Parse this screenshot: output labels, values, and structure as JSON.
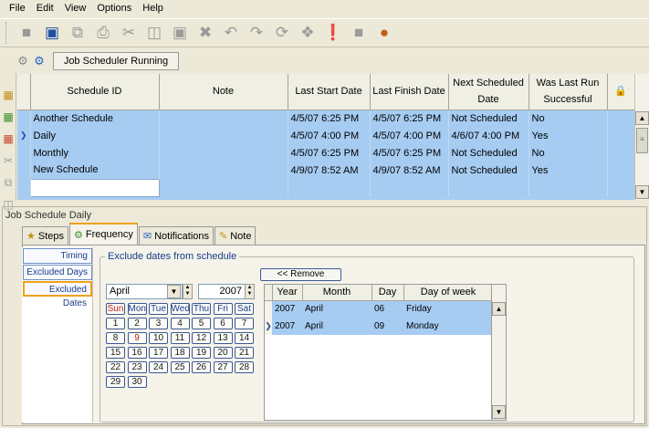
{
  "menu": [
    "File",
    "Edit",
    "View",
    "Options",
    "Help"
  ],
  "toolbar_icons": [
    "new-icon",
    "save-icon",
    "copy-icon",
    "print-icon",
    "cut-icon",
    "paste-icon",
    "clipboard-icon",
    "delete-icon",
    "undo-icon",
    "redo-icon",
    "refresh-icon",
    "link-icon",
    "unlink-icon",
    "settings-icon",
    "user-icon"
  ],
  "status": {
    "label": "Job Scheduler Running"
  },
  "grid": {
    "columns": [
      "Schedule ID",
      "Note",
      "Last Start Date",
      "Last Finish Date",
      "Next Scheduled Date",
      "Was Last Run Successful"
    ],
    "rows": [
      {
        "id": "Another Schedule",
        "note": "",
        "last_start": "4/5/07 6:25 PM",
        "last_finish": "4/5/07 6:25 PM",
        "next": "Not Scheduled",
        "success": "No",
        "current": false
      },
      {
        "id": "Daily",
        "note": "",
        "last_start": "4/5/07 4:00 PM",
        "last_finish": "4/5/07 4:00 PM",
        "next": "4/6/07 4:00 PM",
        "success": "Yes",
        "current": true
      },
      {
        "id": "Monthly",
        "note": "",
        "last_start": "4/5/07 6:25 PM",
        "last_finish": "4/5/07 6:25 PM",
        "next": "Not Scheduled",
        "success": "No",
        "current": false
      },
      {
        "id": "New Schedule",
        "note": "",
        "last_start": "4/9/07 8:52 AM",
        "last_finish": "4/9/07 8:52 AM",
        "next": "Not Scheduled",
        "success": "Yes",
        "current": false
      }
    ]
  },
  "detail": {
    "title": "Job Schedule Daily",
    "tabs": [
      "Steps",
      "Frequency",
      "Notifications",
      "Note"
    ],
    "selected_tab": "Frequency",
    "freq_items": [
      "Timing",
      "Excluded Days",
      "Excluded Dates"
    ],
    "selected_freq_item": "Excluded Dates",
    "exclude_title": "Exclude dates from schedule",
    "remove_label": "<< Remove",
    "calendar": {
      "month": "April",
      "year": "2007",
      "dow": [
        "Sun",
        "Mon",
        "Tue",
        "Wed",
        "Thu",
        "Fri",
        "Sat"
      ],
      "weeks": [
        [
          "1",
          "2",
          "3",
          "4",
          "5",
          "6",
          "7"
        ],
        [
          "8",
          "9",
          "10",
          "11",
          "12",
          "13",
          "14"
        ],
        [
          "15",
          "16",
          "17",
          "18",
          "19",
          "20",
          "21"
        ],
        [
          "22",
          "23",
          "24",
          "25",
          "26",
          "27",
          "28"
        ],
        [
          "29",
          "30"
        ]
      ],
      "excluded_days": [
        "9"
      ]
    },
    "excluded_columns": [
      "Year",
      "Month",
      "Day",
      "Day of week"
    ],
    "excluded_dates": [
      {
        "year": "2007",
        "month": "April",
        "day": "06",
        "dow": "Friday",
        "current": false
      },
      {
        "year": "2007",
        "month": "April",
        "day": "09",
        "dow": "Monday",
        "current": true
      }
    ]
  }
}
